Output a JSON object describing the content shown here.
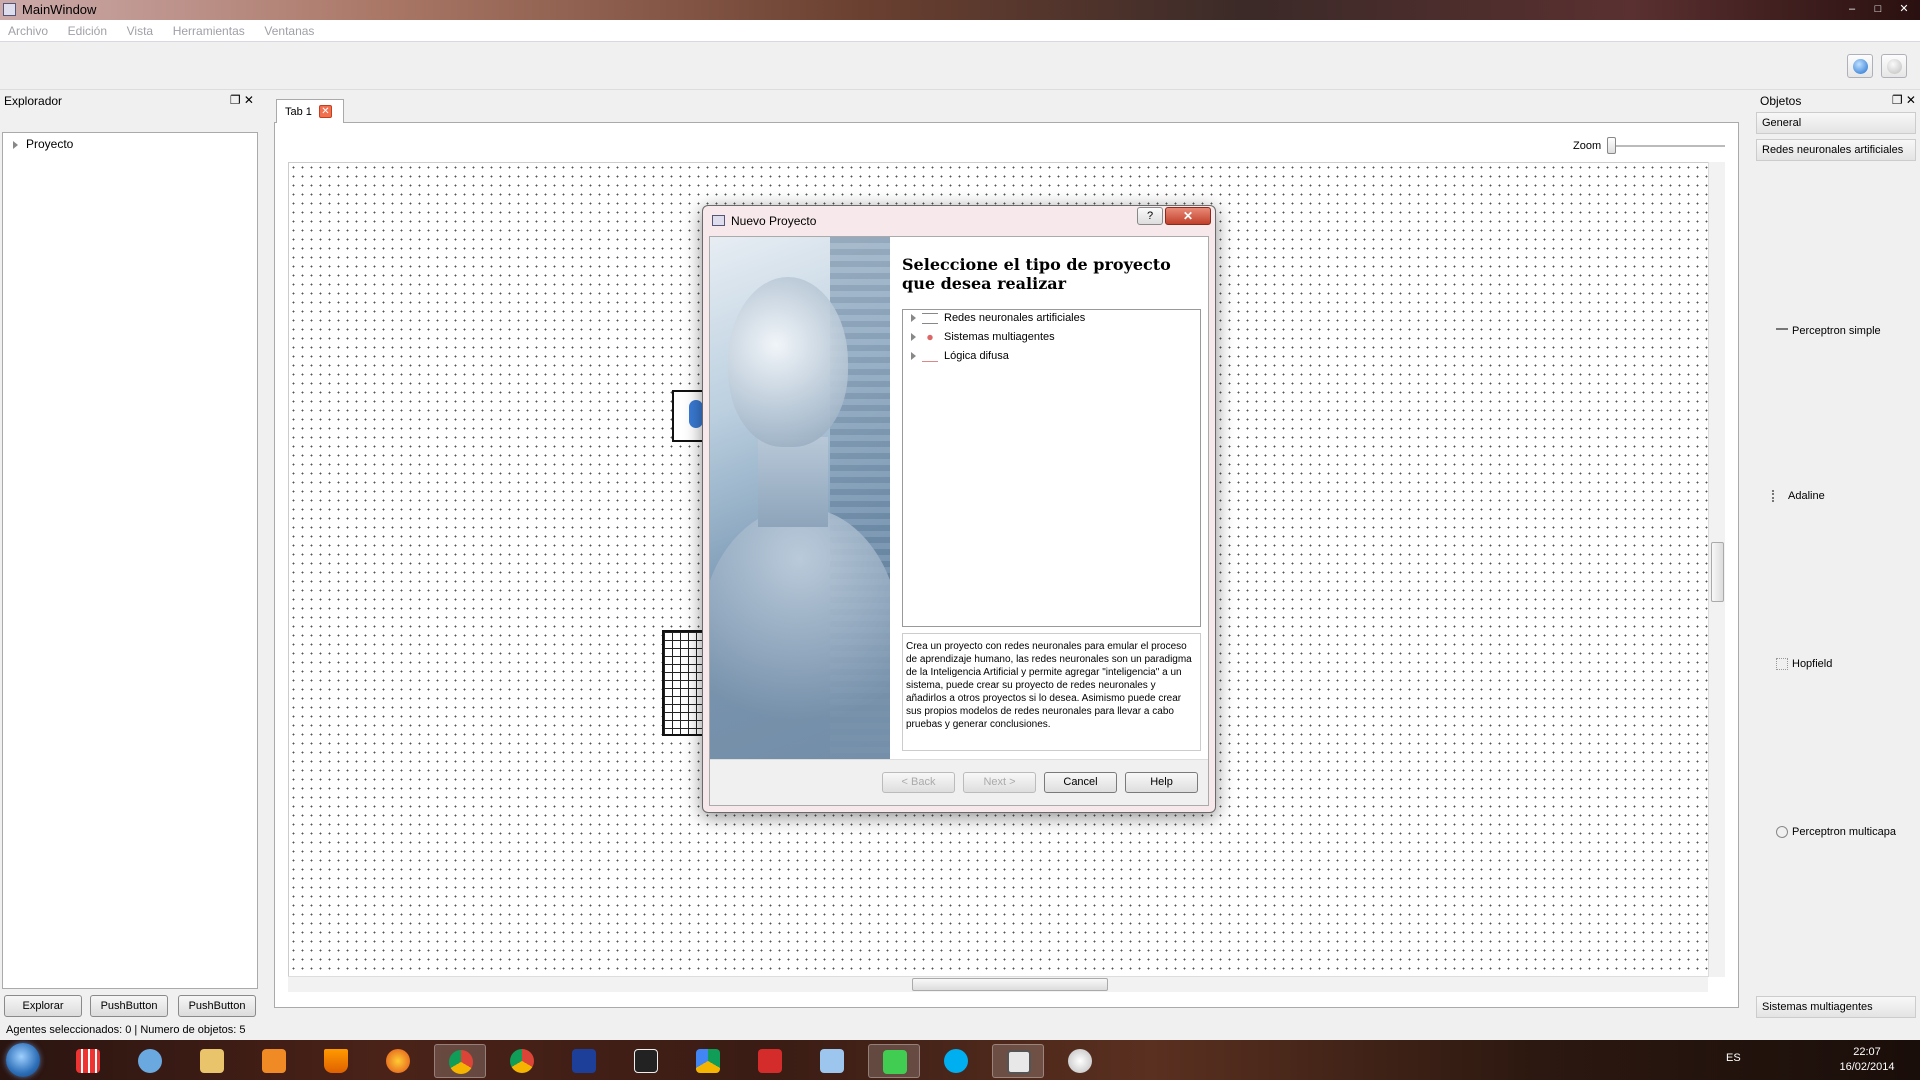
{
  "window": {
    "title": "MainWindow"
  },
  "menu": [
    "Archivo",
    "Edición",
    "Vista",
    "Herramientas",
    "Ventanas"
  ],
  "explorer": {
    "title": "Explorador",
    "tree_root": "Proyecto",
    "buttons": [
      "Explorar",
      "PushButton",
      "PushButton"
    ]
  },
  "tab": {
    "label": "Tab 1",
    "close_glyph": "✕"
  },
  "zoom": {
    "label": "Zoom"
  },
  "objects": {
    "title": "Objetos",
    "sections": [
      "General",
      "Redes neuronales artificiales"
    ],
    "items": [
      "Perceptron simple",
      "Adaline",
      "Hopfield",
      "Perceptron multicapa"
    ],
    "bottom_section": "Sistemas multiagentes"
  },
  "status": {
    "text": "Agentes seleccionados: 0 | Numero de objetos: 5"
  },
  "dialog": {
    "title": "Nuevo Proyecto",
    "help_glyph": "?",
    "close_glyph": "✕",
    "heading": "Seleccione el tipo de proyecto que desea realizar",
    "project_types": [
      "Redes neuronales artificiales",
      "Sistemas multiagentes",
      "Lógica difusa"
    ],
    "description": "Crea un proyecto con redes neuronales para emular el proceso de aprendizaje humano, las redes neuronales son un paradigma de la Inteligencia Artificial y permite agregar \"inteligencia\" a un sistema, puede crear su proyecto de redes neuronales y añadirlos a otros proyectos si lo desea. Asimismo puede crear sus propios modelos de redes neuronales para llevar a cabo pruebas y generar conclusiones.",
    "buttons": {
      "back": "< Back",
      "next": "Next >",
      "cancel": "Cancel",
      "help": "Help"
    }
  },
  "taskbar": {
    "language": "ES",
    "time": "22:07",
    "date": "16/02/2014"
  },
  "colors": {
    "accent": "#3a7bd5",
    "dialog_bg": "#f7e9eb",
    "close_red": "#c0402a"
  }
}
